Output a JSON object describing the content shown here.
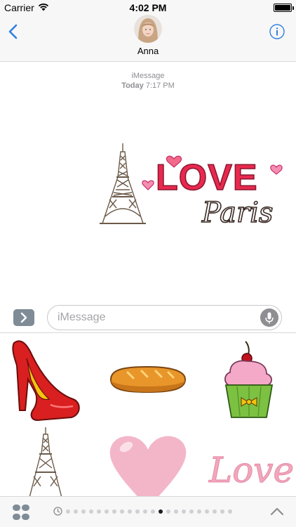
{
  "status_bar": {
    "carrier": "Carrier",
    "time": "4:02 PM"
  },
  "nav": {
    "contact_name": "Anna"
  },
  "conversation": {
    "service": "iMessage",
    "day": "Today",
    "time": "7:17 PM"
  },
  "sticker_message": {
    "text_love": "LOVE",
    "text_script": "Paris"
  },
  "composer": {
    "placeholder": "iMessage"
  },
  "drawer": {
    "items": [
      {
        "icon": "red-high-heel-icon"
      },
      {
        "icon": "baguette-icon"
      },
      {
        "icon": "cupcake-icon"
      },
      {
        "icon": "eiffel-tower-icon"
      },
      {
        "icon": "pink-heart-icon"
      },
      {
        "icon": "love-script-icon",
        "text": "Love"
      }
    ]
  },
  "pager": {
    "page_count": 22,
    "active_index": 12
  },
  "colors": {
    "ios_blue": "#2f7fe5",
    "love_red": "#e8294e",
    "heart_pink": "#f3b6c9"
  }
}
